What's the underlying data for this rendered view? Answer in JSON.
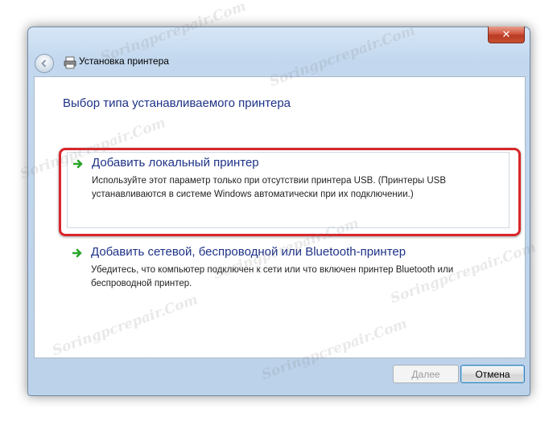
{
  "window": {
    "title": "Установка принтера",
    "close_label": "✕"
  },
  "page": {
    "heading": "Выбор типа устанавливаемого принтера"
  },
  "options": [
    {
      "title": "Добавить локальный принтер",
      "description": "Используйте этот параметр только при отсутствии принтера USB. (Принтеры USB устанавливаются в системе Windows автоматически при их подключении.)"
    },
    {
      "title": "Добавить сетевой, беспроводной или Bluetooth-принтер",
      "description": "Убедитесь, что компьютер подключен к сети или что включен принтер Bluetooth или беспроводной принтер."
    }
  ],
  "footer": {
    "next_label": "Далее",
    "cancel_label": "Отмена"
  },
  "watermark": {
    "text": "Soringpcrepair.Com"
  },
  "colors": {
    "link_blue": "#1e3287",
    "arrow_green": "#2aa52a",
    "highlight_red": "#d8262b"
  }
}
